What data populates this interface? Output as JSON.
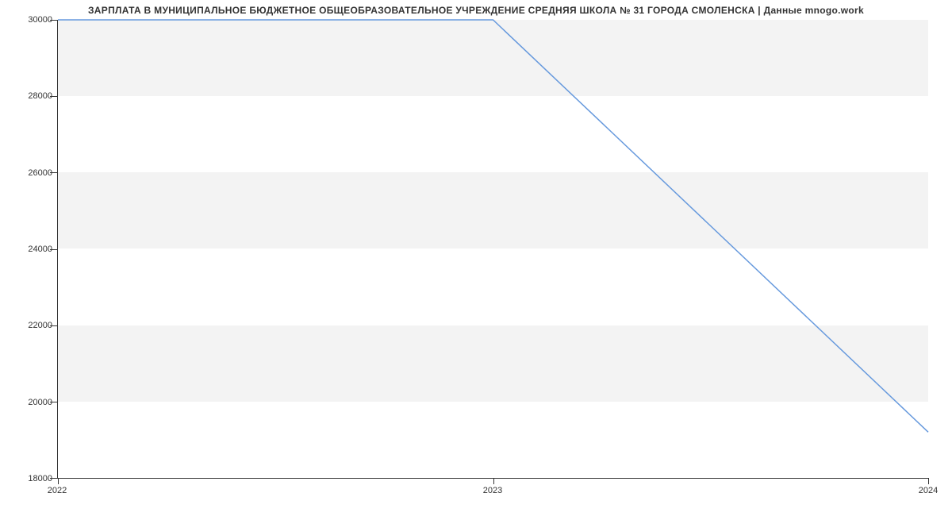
{
  "chart_data": {
    "type": "line",
    "title": "ЗАРПЛАТА В МУНИЦИПАЛЬНОЕ БЮДЖЕТНОЕ ОБЩЕОБРАЗОВАТЕЛЬНОЕ УЧРЕЖДЕНИЕ СРЕДНЯЯ  ШКОЛА № 31 ГОРОДА СМОЛЕНСКА | Данные mnogo.work",
    "x": [
      2022,
      2023,
      2024
    ],
    "values": [
      30000,
      30000,
      19200
    ],
    "xlabel": "",
    "ylabel": "",
    "ylim": [
      18000,
      30000
    ],
    "xlim": [
      2022,
      2024
    ],
    "y_ticks": [
      18000,
      20000,
      22000,
      24000,
      26000,
      28000,
      30000
    ],
    "y_tick_labels": [
      "18000",
      "20000",
      "22000",
      "24000",
      "26000",
      "28000",
      "30000"
    ],
    "x_ticks": [
      2022,
      2023,
      2024
    ],
    "x_tick_labels": [
      "2022",
      "2023",
      "2024"
    ]
  }
}
